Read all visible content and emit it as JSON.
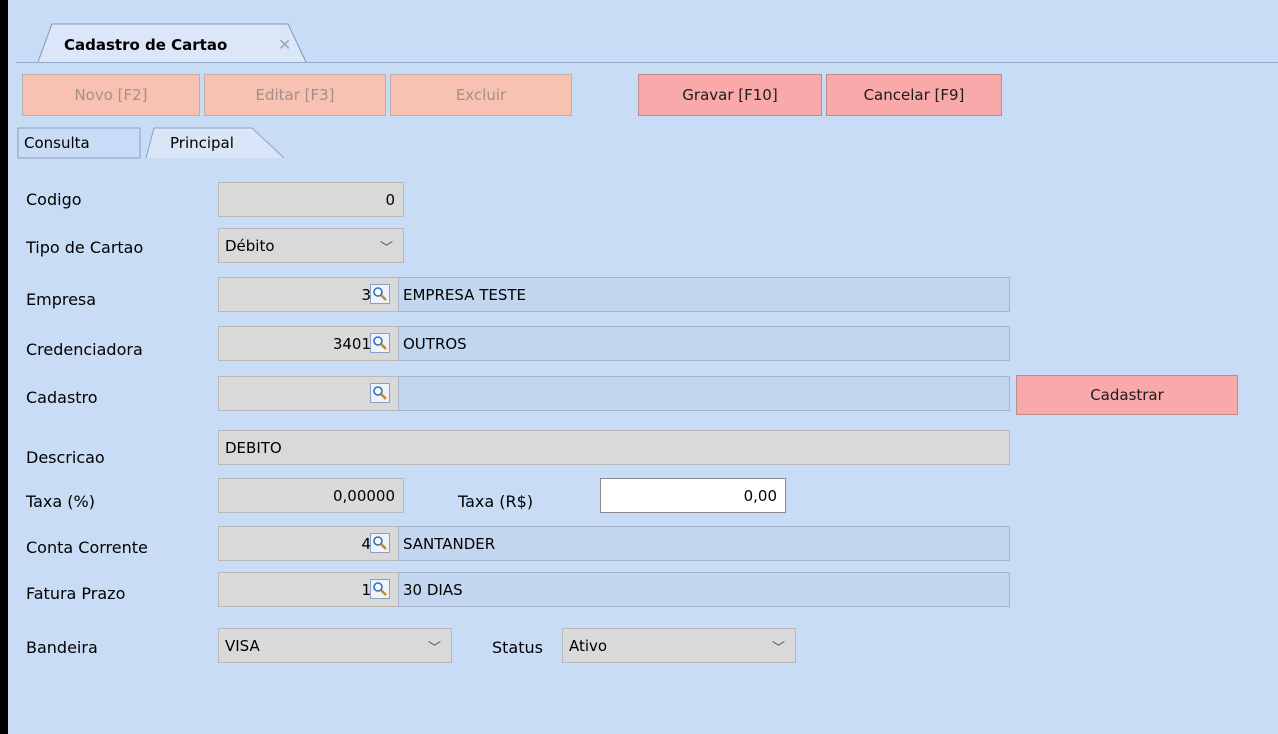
{
  "window_tab": {
    "title": "Cadastro de Cartao",
    "close_glyph": "✕"
  },
  "toolbar": {
    "novo": "Novo [F2]",
    "editar": "Editar [F3]",
    "excluir": "Excluir",
    "gravar": "Gravar [F10]",
    "cancelar": "Cancelar [F9]"
  },
  "tabs": {
    "consulta": "Consulta",
    "principal": "Principal"
  },
  "form": {
    "codigo": {
      "label": "Codigo",
      "value": "0"
    },
    "tipo_cartao": {
      "label": "Tipo de Cartao",
      "value": "Débito"
    },
    "empresa": {
      "label": "Empresa",
      "code": "3",
      "description": "EMPRESA TESTE"
    },
    "credenciadora": {
      "label": "Credenciadora",
      "code": "3401",
      "description": "OUTROS"
    },
    "cadastro": {
      "label": "Cadastro",
      "code": "",
      "description": "",
      "button": "Cadastrar"
    },
    "descricao": {
      "label": "Descricao",
      "value": "DEBITO"
    },
    "taxa_pct": {
      "label": "Taxa (%)",
      "value": "0,00000"
    },
    "taxa_rs": {
      "label": "Taxa (R$)",
      "value": "0,00"
    },
    "conta_corrente": {
      "label": "Conta Corrente",
      "code": "4",
      "description": "SANTANDER"
    },
    "fatura_prazo": {
      "label": "Fatura Prazo",
      "code": "1",
      "description": "30 DIAS"
    },
    "bandeira": {
      "label": "Bandeira",
      "value": "VISA"
    },
    "status": {
      "label": "Status",
      "value": "Ativo"
    }
  },
  "icons": {
    "lookup": "magnifier-icon",
    "dropdown": "chevron-down-icon"
  },
  "colors": {
    "background": "#c9dcf6",
    "button_active": "#f9a9a9",
    "button_disabled": "#f7c2b2",
    "field_readonly": "#d9d9d9"
  }
}
